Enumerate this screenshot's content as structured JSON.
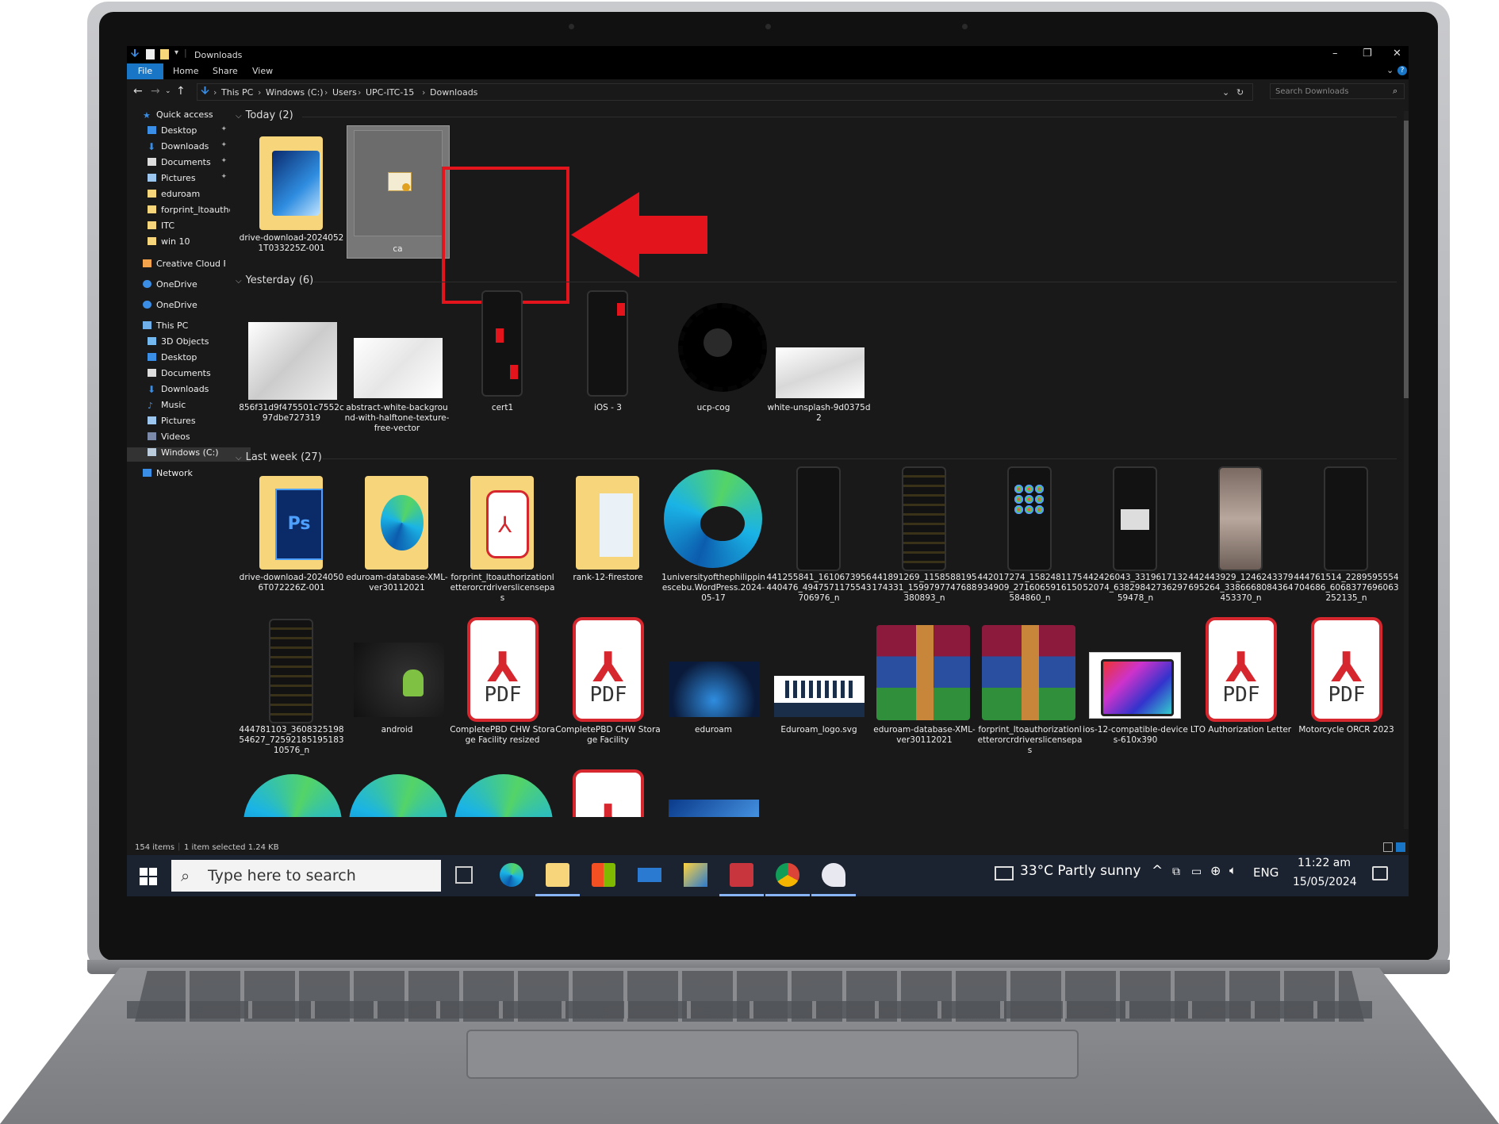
{
  "window": {
    "title": "Downloads"
  },
  "ribbon": {
    "file": "File",
    "home": "Home",
    "share": "Share",
    "view": "View"
  },
  "address": {
    "crumbs": [
      "This PC",
      "Windows (C:)",
      "Users",
      "UPC-ITC-15",
      "Downloads"
    ],
    "search_placeholder": "Search Downloads"
  },
  "sidebar": {
    "items": [
      {
        "label": "Quick access",
        "icon": "star-icon"
      },
      {
        "label": "Desktop",
        "icon": "desktop-icon"
      },
      {
        "label": "Downloads",
        "icon": "download-icon"
      },
      {
        "label": "Documents",
        "icon": "document-icon"
      },
      {
        "label": "Pictures",
        "icon": "pictures-icon"
      },
      {
        "label": "eduroam",
        "icon": "folder-icon"
      },
      {
        "label": "forprint_ltoauthoriz",
        "icon": "folder-icon"
      },
      {
        "label": "ITC",
        "icon": "folder-icon"
      },
      {
        "label": "win 10",
        "icon": "folder-icon"
      },
      {
        "label": "Creative Cloud Files",
        "icon": "creative-cloud-icon"
      },
      {
        "label": "OneDrive",
        "icon": "onedrive-icon"
      },
      {
        "label": "OneDrive",
        "icon": "onedrive-icon"
      },
      {
        "label": "This PC",
        "icon": "pc-icon"
      },
      {
        "label": "3D Objects",
        "icon": "cube-icon"
      },
      {
        "label": "Desktop",
        "icon": "desktop-icon"
      },
      {
        "label": "Documents",
        "icon": "document-icon"
      },
      {
        "label": "Downloads",
        "icon": "download-icon"
      },
      {
        "label": "Music",
        "icon": "music-icon"
      },
      {
        "label": "Pictures",
        "icon": "pictures-icon"
      },
      {
        "label": "Videos",
        "icon": "video-icon"
      },
      {
        "label": "Windows (C:)",
        "icon": "drive-icon"
      },
      {
        "label": "Network",
        "icon": "network-icon"
      }
    ]
  },
  "groups": {
    "today": "Today (2)",
    "yesterday": "Yesterday (6)",
    "lastweek": "Last week (27)"
  },
  "files": {
    "today": [
      "drive-download-20240521T033225Z-001",
      "ca"
    ],
    "yesterday": [
      "856f31d9f475501c7552c97dbe727319",
      "abstract-white-background-with-halftone-texture-free-vector",
      "cert1",
      "iOS - 3",
      "ucp-cog",
      "white-unsplash-9d0375d2"
    ],
    "lastweek1": [
      "drive-download-20240506T072226Z-001",
      "eduroam-database-XML-ver30112021",
      "forprint_ltoauthorizationletterorcrdriverslicensepas",
      "rank-12-firestore",
      "1universityofthephilippinescebu.WordPress.2024-05-17",
      "441255841_1610673956440476_4947571175543706976_n",
      "441891269_1158588195174331_1599797747688380893_n",
      "442017274_1582481175934909_2716065916150584860_n",
      "442426043_331961713252074_6382984273629759478_n",
      "442443929_1246243379695264_3386668084364453370_n",
      "444761514_2289595554704686_6068377696063252135_n"
    ],
    "lastweek2": [
      "444781103_360832519854627_7259218519518310576_n",
      "android",
      "CompletePBD CHW Storage Facility resized",
      "CompletePBD CHW Storage Facility",
      "eduroam",
      "Eduroam_logo.svg",
      "eduroam-database-XML-ver30112021",
      "forprint_ltoauthorizationletterorcrdriverslicensepas",
      "ios-12-compatible-devices-610x390",
      "LTO Authorization Letter",
      "Motorcycle ORCR 2023"
    ]
  },
  "status": {
    "count": "154 items",
    "selected": "1 item selected  1.24 KB"
  },
  "taskbar": {
    "search_placeholder": "Type here to search",
    "weather": "33°C  Partly sunny",
    "lang": "ENG",
    "time": "11:22 am",
    "date": "15/05/2024"
  },
  "colors": {
    "accent": "#1976c6",
    "highlight": "#e3141c",
    "selected_bg": "#777777"
  }
}
